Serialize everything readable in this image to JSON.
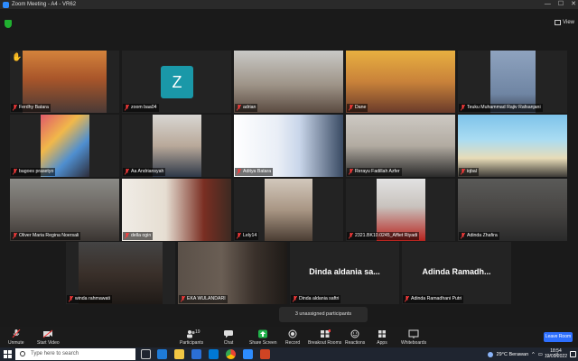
{
  "window": {
    "title": "Zoom Meeting - A4 - VR62"
  },
  "view": {
    "label": "View"
  },
  "participants": [
    {
      "name": "Ferdhy Batara"
    },
    {
      "name": "zoom baa04",
      "initial": "Z"
    },
    {
      "name": "adrian"
    },
    {
      "name": "Dane"
    },
    {
      "name": "Teuku Muhammad Rajiv Rafsanjani"
    },
    {
      "name": "bagoes prasetyo"
    },
    {
      "name": "Aa Andriansyah"
    },
    {
      "name": "Aditya Batara"
    },
    {
      "name": "Rerayu Fadillah Azfer"
    },
    {
      "name": "iqbal"
    },
    {
      "name": "Oliver Maria Regina Noersali"
    },
    {
      "name": "della ogin"
    },
    {
      "name": "Lely14"
    },
    {
      "name": "2321.BK10.0245_Affiet Riyadi"
    },
    {
      "name": "Adinda Zhafira"
    },
    {
      "name": "winda rahmawati"
    },
    {
      "name": "EKA WULANDARI"
    },
    {
      "name": "Dinda aldania saftri",
      "display": "Dinda aldania sa..."
    },
    {
      "name": "Adinda Ramadhani Putri",
      "display": "Adinda Ramadh..."
    }
  ],
  "tooltip": {
    "text": "3 unassigned participants"
  },
  "toolbar": {
    "unmute": "Unmute",
    "start_video": "Start Video",
    "participants": "Participants",
    "participants_count": "19",
    "chat": "Chat",
    "share_screen": "Share Screen",
    "record": "Record",
    "breakout_rooms": "Breakout Rooms",
    "reactions": "Reactions",
    "apps": "Apps",
    "whiteboards": "Whiteboards",
    "leave_room": "Leave Room"
  },
  "taskbar": {
    "search_placeholder": "Type here to search",
    "weather": "29°C  Berawan",
    "time": "18:54",
    "date": "12/09/2022"
  }
}
